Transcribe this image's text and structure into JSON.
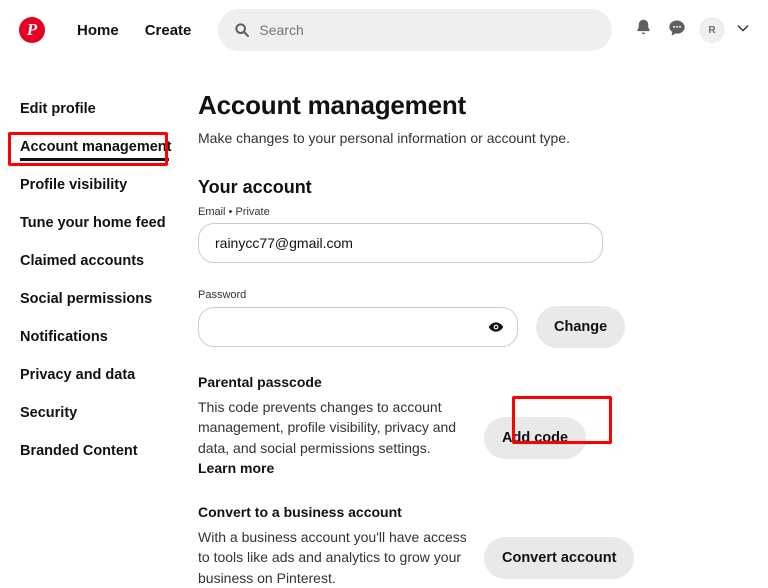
{
  "header": {
    "logo_icon": "pinterest-logo-icon",
    "logo_letter": "P",
    "nav": [
      {
        "label": "Home"
      },
      {
        "label": "Create"
      }
    ],
    "search": {
      "icon": "search-icon",
      "placeholder": "Search",
      "value": ""
    },
    "actions": [
      {
        "name": "notifications-icon"
      },
      {
        "name": "messages-icon"
      }
    ],
    "avatar_initial": "R",
    "chevron_icon": "chevron-down-icon"
  },
  "sidebar": {
    "items": [
      {
        "label": "Edit profile",
        "active": false
      },
      {
        "label": "Account management",
        "active": true
      },
      {
        "label": "Profile visibility",
        "active": false
      },
      {
        "label": "Tune your home feed",
        "active": false
      },
      {
        "label": "Claimed accounts",
        "active": false
      },
      {
        "label": "Social permissions",
        "active": false
      },
      {
        "label": "Notifications",
        "active": false
      },
      {
        "label": "Privacy and data",
        "active": false
      },
      {
        "label": "Security",
        "active": false
      },
      {
        "label": "Branded Content",
        "active": false
      }
    ]
  },
  "main": {
    "title": "Account management",
    "subtitle": "Make changes to your personal information or account type.",
    "section_title": "Your account",
    "email": {
      "label": "Email • Private",
      "value": "rainycc77@gmail.com"
    },
    "password": {
      "label": "Password",
      "value": "",
      "toggle_icon": "eye-icon",
      "change_label": "Change"
    },
    "parental": {
      "heading": "Parental passcode",
      "body": "This code prevents changes to account management, profile visibility, privacy and data, and social permissions settings. ",
      "link_label": "Learn more",
      "button_label": "Add code"
    },
    "business": {
      "heading": "Convert to a business account",
      "body": "With a business account you'll have access to tools like ads and analytics to grow your business on Pinterest.",
      "button_label": "Convert account"
    }
  },
  "highlights": {
    "color": "#ff0000",
    "targets": [
      "sidebar-item-account-management",
      "add-code-button"
    ]
  }
}
